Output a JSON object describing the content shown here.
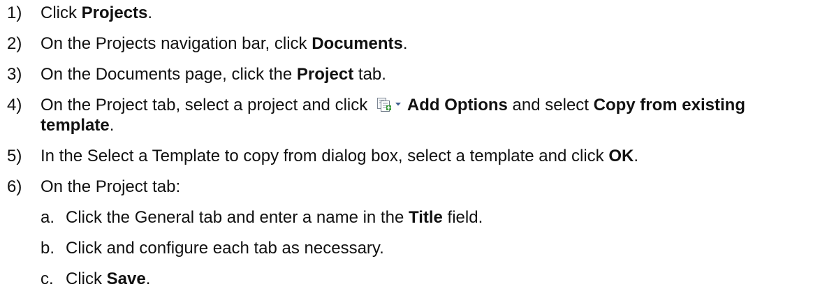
{
  "steps": [
    {
      "num": "1)",
      "parts": [
        {
          "t": "Click "
        },
        {
          "b": "Projects"
        },
        {
          "t": "."
        }
      ]
    },
    {
      "num": "2)",
      "parts": [
        {
          "t": "On the Projects navigation bar, click "
        },
        {
          "b": "Documents"
        },
        {
          "t": "."
        }
      ]
    },
    {
      "num": "3)",
      "parts": [
        {
          "t": "On the Documents page, click the "
        },
        {
          "b": "Project"
        },
        {
          "t": " tab."
        }
      ]
    },
    {
      "num": "4)",
      "parts": [
        {
          "t": "On the Project tab, select a project and click "
        },
        {
          "icon": "add-options-dropdown-icon"
        },
        {
          "b": "Add Options"
        },
        {
          "t": " and select "
        },
        {
          "b": "Copy from existing template"
        },
        {
          "t": "."
        }
      ]
    },
    {
      "num": "5)",
      "parts": [
        {
          "t": "In the Select a Template to copy from dialog box, select a template and click "
        },
        {
          "b": "OK"
        },
        {
          "t": "."
        }
      ]
    },
    {
      "num": "6)",
      "parts": [
        {
          "t": "On the Project tab:"
        }
      ],
      "substeps": [
        {
          "letter": "a.",
          "parts": [
            {
              "t": "Click the General tab and enter a name in the "
            },
            {
              "b": "Title"
            },
            {
              "t": " field."
            }
          ]
        },
        {
          "letter": "b.",
          "parts": [
            {
              "t": "Click and configure each tab as necessary."
            }
          ]
        },
        {
          "letter": "c.",
          "parts": [
            {
              "t": "Click "
            },
            {
              "b": "Save"
            },
            {
              "t": "."
            }
          ]
        }
      ]
    }
  ]
}
